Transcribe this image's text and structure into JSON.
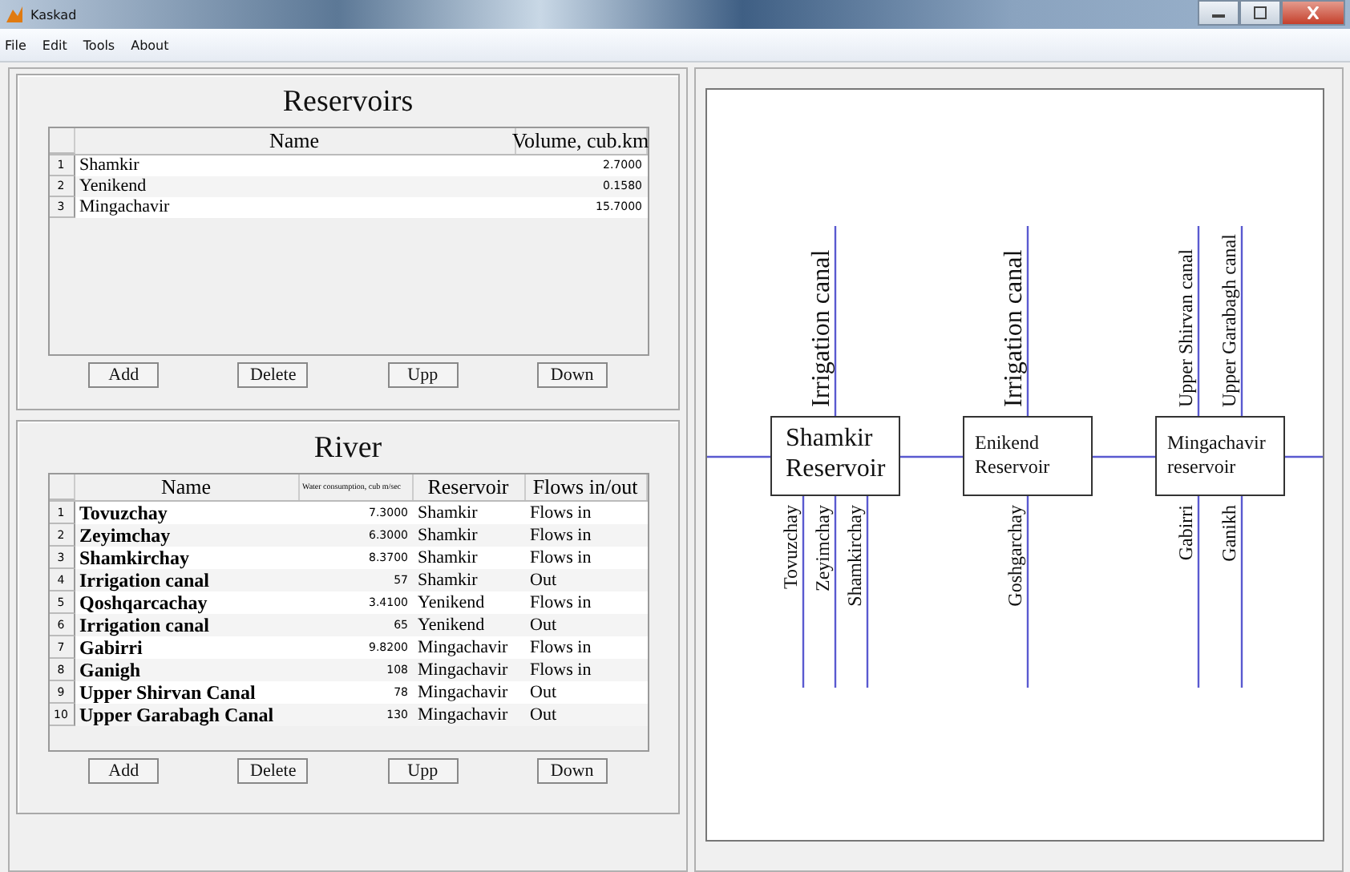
{
  "window": {
    "title": "Kaskad"
  },
  "menu": [
    "File",
    "Edit",
    "Tools",
    "About"
  ],
  "reservoirs_panel": {
    "title": "Reservoirs",
    "columns": [
      "Name",
      "Volume, cub.km"
    ],
    "rows": [
      {
        "number": "1",
        "name": "Shamkir",
        "volume": "2.7000"
      },
      {
        "number": "2",
        "name": "Yenikend",
        "volume": "0.1580"
      },
      {
        "number": "3",
        "name": "Mingachavir",
        "volume": "15.7000"
      }
    ],
    "buttons": [
      "Add",
      "Delete",
      "Upp",
      "Down"
    ]
  },
  "river_panel": {
    "title": "River",
    "columns": [
      "Name",
      "Water consumption, cub m/sec",
      "Reservoir",
      "Flows in/out"
    ],
    "rows": [
      {
        "number": "1",
        "name": "Tovuzchay",
        "consumption": "7.3000",
        "reservoir": "Shamkir",
        "flow": "Flows in"
      },
      {
        "number": "2",
        "name": "Zeyimchay",
        "consumption": "6.3000",
        "reservoir": "Shamkir",
        "flow": "Flows in"
      },
      {
        "number": "3",
        "name": "Shamkirchay",
        "consumption": "8.3700",
        "reservoir": "Shamkir",
        "flow": "Flows in"
      },
      {
        "number": "4",
        "name": "Irrigation canal",
        "consumption": "57",
        "reservoir": "Shamkir",
        "flow": "Out"
      },
      {
        "number": "5",
        "name": "Qoshqarcachay",
        "consumption": "3.4100",
        "reservoir": "Yenikend",
        "flow": "Flows in"
      },
      {
        "number": "6",
        "name": "Irrigation canal",
        "consumption": "65",
        "reservoir": "Yenikend",
        "flow": "Out"
      },
      {
        "number": "7",
        "name": "Gabirri",
        "consumption": "9.8200",
        "reservoir": "Mingachavir",
        "flow": "Flows in"
      },
      {
        "number": "8",
        "name": "Ganigh",
        "consumption": "108",
        "reservoir": "Mingachavir",
        "flow": "Flows in"
      },
      {
        "number": "9",
        "name": "Upper Shirvan Canal",
        "consumption": "78",
        "reservoir": "Mingachavir",
        "flow": "Out"
      },
      {
        "number": "10",
        "name": "Upper Garabagh Canal",
        "consumption": "130",
        "reservoir": "Mingachavir",
        "flow": "Out"
      }
    ],
    "buttons": [
      "Add",
      "Delete",
      "Upp",
      "Down"
    ]
  },
  "diagram": {
    "reservoirs": [
      {
        "label_lines": [
          "Shamkir",
          "Reservoir"
        ],
        "outflows": [
          "Irrigation canal"
        ],
        "inflows": [
          "Tovuzchay",
          "Zeyimchay",
          "Shamkirchay"
        ]
      },
      {
        "label_lines": [
          "Enikend",
          "Reservoir"
        ],
        "outflows": [
          "Irrigation canal"
        ],
        "inflows": [
          "Goshgarchay"
        ]
      },
      {
        "label_lines": [
          "Mingachavir",
          "reservoir"
        ],
        "outflows": [
          "Upper Shirvan canal",
          "Upper Garabagh canal"
        ],
        "inflows": [
          "Gabirri",
          "Ganikh"
        ]
      }
    ]
  }
}
